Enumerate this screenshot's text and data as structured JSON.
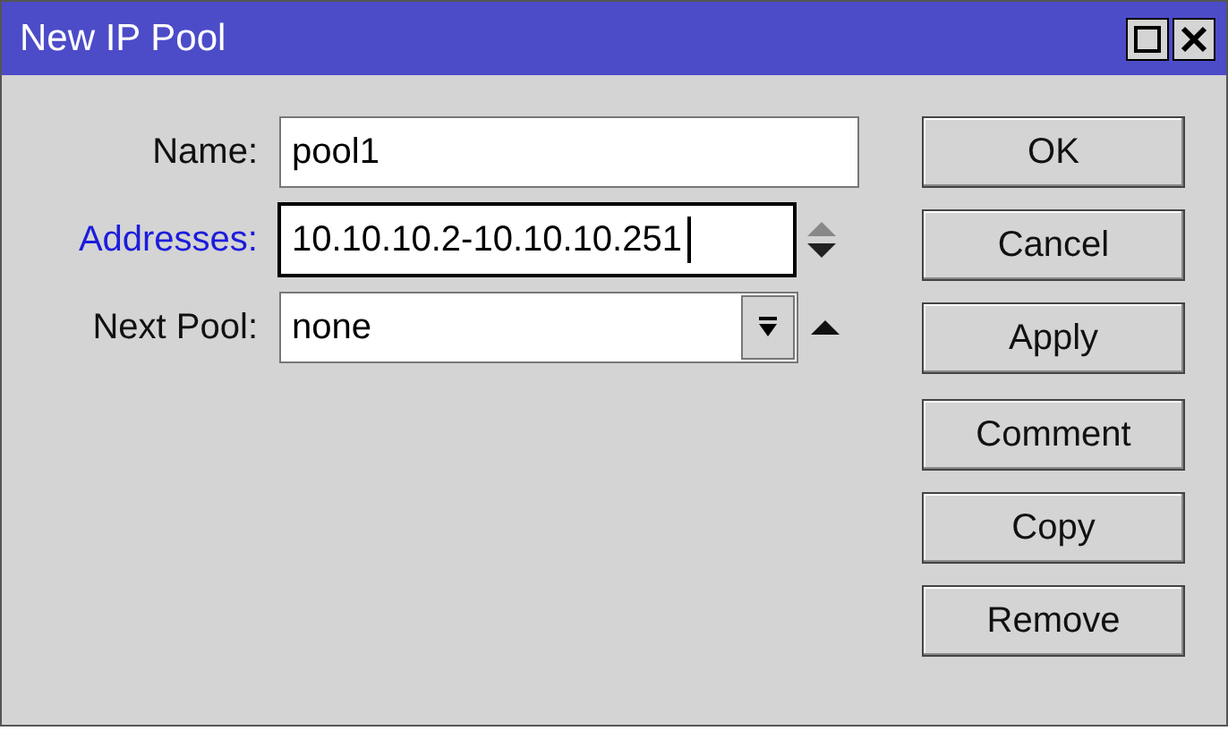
{
  "window": {
    "title": "New IP Pool"
  },
  "fields": [
    {
      "kind": "text",
      "label": "Name:",
      "value": "pool1",
      "highlighted": false,
      "focused": false
    },
    {
      "kind": "multi",
      "label": "Addresses:",
      "value": "10.10.10.2-10.10.10.251",
      "highlighted": true,
      "focused": true
    },
    {
      "kind": "select",
      "label": "Next Pool:",
      "value": "none",
      "highlighted": false,
      "focused": false
    }
  ],
  "button_groups": [
    [
      "OK",
      "Cancel",
      "Apply"
    ],
    [
      "Comment",
      "Copy",
      "Remove"
    ]
  ]
}
